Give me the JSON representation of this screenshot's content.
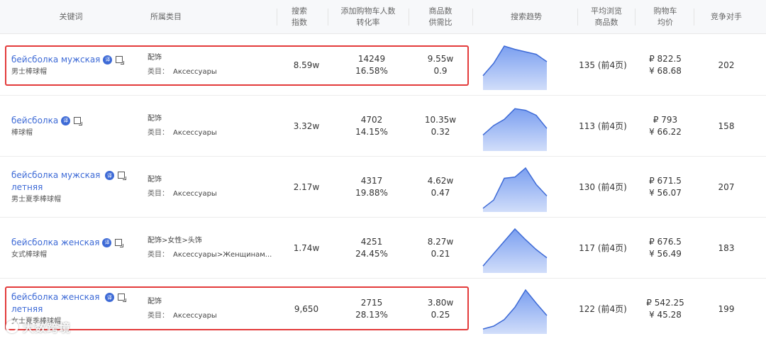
{
  "headers": {
    "keyword": "关键词",
    "category": "所属类目",
    "search_index": [
      "搜索",
      "指数"
    ],
    "cart": [
      "添加购物车人数",
      "转化率"
    ],
    "supply": [
      "商品数",
      "供需比"
    ],
    "trend": "搜索趋势",
    "browse": [
      "平均浏览",
      "商品数"
    ],
    "price": [
      "购物车",
      "均价"
    ],
    "competitors": "竞争对手"
  },
  "rows": [
    {
      "keyword": "бейсболка мужская",
      "translation": "男士棒球帽",
      "category1": "配饰",
      "category_label": "类目：",
      "category2": "Аксессуары",
      "search_index": "8.59w",
      "cart_count": "14249",
      "conversion": "16.58%",
      "product_count": "9.55w",
      "supply_ratio": "0.9",
      "browse": "135 (前4页)",
      "price_rub": "₽ 822.5",
      "price_cny": "¥ 68.68",
      "competitors": "202",
      "trend": [
        0.28,
        0.58,
        1.0,
        0.92,
        0.86,
        0.8,
        0.62
      ],
      "highlighted": true
    },
    {
      "keyword": "бейсболка",
      "translation": "棒球帽",
      "category1": "配饰",
      "category_label": "类目：",
      "category2": "Аксессуары",
      "search_index": "3.32w",
      "cart_count": "4702",
      "conversion": "14.15%",
      "product_count": "10.35w",
      "supply_ratio": "0.32",
      "browse": "113 (前4页)",
      "price_rub": "₽ 793",
      "price_cny": "¥ 66.22",
      "competitors": "158",
      "trend": [
        0.32,
        0.55,
        0.7,
        0.96,
        0.92,
        0.8,
        0.48
      ],
      "highlighted": false
    },
    {
      "keyword": "бейсболка мужская летняя",
      "translation": "男士夏季棒球帽",
      "category1": "配饰",
      "category_label": "类目：",
      "category2": "Аксессуары",
      "search_index": "2.17w",
      "cart_count": "4317",
      "conversion": "19.88%",
      "product_count": "4.62w",
      "supply_ratio": "0.47",
      "browse": "130 (前4页)",
      "price_rub": "₽ 671.5",
      "price_cny": "¥ 56.07",
      "competitors": "207",
      "trend": [
        0.02,
        0.22,
        0.75,
        0.78,
        1.0,
        0.6,
        0.32
      ],
      "highlighted": false
    },
    {
      "keyword": "бейсболка женская",
      "translation": "女式棒球帽",
      "category1": "配饰>女性>头饰",
      "category_label": "类目：",
      "category2": "Аксессуары>Женщинам...",
      "search_index": "1.74w",
      "cart_count": "4251",
      "conversion": "24.45%",
      "product_count": "8.27w",
      "supply_ratio": "0.21",
      "browse": "117 (前4页)",
      "price_rub": "₽ 676.5",
      "price_cny": "¥ 56.49",
      "competitors": "183",
      "trend": [
        0.1,
        0.4,
        0.7,
        1.0,
        0.74,
        0.5,
        0.3
      ],
      "highlighted": false
    },
    {
      "keyword": "бейсболка женская летняя",
      "translation": "女士夏季棒球帽",
      "category1": "配饰",
      "category_label": "类目：",
      "category2": "Аксессуары",
      "search_index": "9,650",
      "cart_count": "2715",
      "conversion": "28.13%",
      "product_count": "3.80w",
      "supply_ratio": "0.25",
      "browse": "122 (前4页)",
      "price_rub": "₽ 542.25",
      "price_cny": "¥ 45.28",
      "competitors": "199",
      "trend": [
        0.05,
        0.12,
        0.28,
        0.58,
        1.0,
        0.68,
        0.38
      ],
      "highlighted": true
    }
  ],
  "watermark": "大数跨境",
  "badge_label": "译",
  "colors": {
    "link": "#3d6ad6",
    "highlight": "#e33b3b",
    "trend_fill": "#7b9ff0",
    "trend_line": "#3d6ad6"
  }
}
